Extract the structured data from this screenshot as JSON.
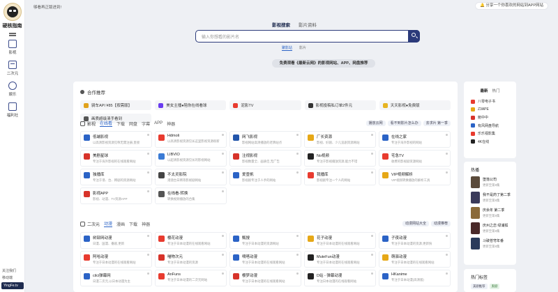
{
  "brand": {
    "name": "硬核指南"
  },
  "sidebar": {
    "items": [
      {
        "label": "影视",
        "icon": "film-icon"
      },
      {
        "label": "二次元",
        "icon": "anime-icon"
      },
      {
        "label": "娱乐",
        "icon": "game-icon"
      },
      {
        "label": "福利社",
        "icon": "gift-icon"
      }
    ],
    "bottom_text": "关注我们",
    "bottom_text2": "移动端",
    "site_badge": "YingFe.tv"
  },
  "topbar": {
    "welcome": "够看再正版进到!",
    "share": "分享一个你喜欢的网站到APP网站"
  },
  "hero": {
    "tabs": [
      "影视搜索",
      "影片资料"
    ],
    "search_placeholder": "输入你想看的影片名",
    "sub_tabs": [
      "聚影站",
      "影片"
    ],
    "note": "免费观看《最新云网》的影视网站、APP、网盘推荐"
  },
  "partners_title": "合作推荐",
  "partners": [
    {
      "label": "骑车API ¥85【按需版】",
      "color": "#e0a21c"
    },
    {
      "label": "美女主播●陪你在线看球",
      "color": "#6a3cf0"
    },
    {
      "label": "泥影TV",
      "color": "#e83b2f"
    },
    {
      "label": "影视投稿私订单2件元",
      "color": "#333333"
    },
    {
      "label": "天天影视●免费版",
      "color": "#e6b422"
    },
    {
      "label": "画质超级清手看到",
      "color": "#555555"
    }
  ],
  "film_section": {
    "name": "影视",
    "tabs": [
      "在线看",
      "下载",
      "网盘",
      "字幕",
      "APP",
      "神器"
    ],
    "pills": [
      "播放云网",
      "看不到影片怎么办",
      "去求片 第一季"
    ]
  },
  "film_cards": [
    {
      "name": "低端影视",
      "desc": "以高清影视资源见称无需注册,直接",
      "color": "#2b63c6"
    },
    {
      "name": "Hdmoli",
      "desc": "以高清影视资源见长这里影视资源很新",
      "color": "#e83b2f"
    },
    {
      "name": "网飞影视",
      "desc": "影视网站高清播放的老牌站点",
      "color": "#2255aa"
    },
    {
      "name": "厂长资源",
      "desc": "影视、好剧、少儿追剧资源网站",
      "color": "#e6a817"
    },
    {
      "name": "在线之家",
      "desc": "专注于海外影视的网站",
      "color": "#2b63c6"
    },
    {
      "name": "美剧星球",
      "desc": "专注于海外影视的在线观看网站",
      "color": "#d7332a"
    },
    {
      "name": "LIBVIO",
      "desc": "以超清影视资源见长的影视网站",
      "color": "#3a7bd5"
    },
    {
      "name": "注视影视",
      "desc": "影视数量全、画质佳,无广告",
      "color": "#d7332a"
    },
    {
      "name": "No视频",
      "desc": "专注于影视播放资源,能力不错",
      "color": "#222222"
    },
    {
      "name": "宅急TV",
      "desc": "收费的影视剧资源网站",
      "color": "#e83b2f"
    },
    {
      "name": "独播库",
      "desc": "专注于港、台、韩剧的资源网站",
      "color": "#2b63c6"
    },
    {
      "name": "不太灵影院",
      "desc": "港澳台日韩等影视剧网站",
      "color": "#444444"
    },
    {
      "name": "爱壹帆",
      "desc": "影视剧专注于人手的网站",
      "color": "#2b63c6"
    },
    {
      "name": "我播库",
      "desc": "影视剧专注一个人的网站",
      "color": "#e83b2f"
    },
    {
      "name": "VIP视频解析",
      "desc": "VIP视频转换播放的解析工具",
      "color": "#e6a817"
    },
    {
      "name": "影视APP",
      "desc": "影视、动漫、TV资源APP",
      "color": "#d7332a"
    },
    {
      "name": "在线看-转换",
      "desc": "转换视频播放的合集",
      "color": "#555555"
    }
  ],
  "anime_section": {
    "name": "二次元",
    "tabs": [
      "动漫",
      "漫画",
      "下载",
      "神器"
    ],
    "pills": [
      "动漫网站大全",
      "动漫推荐"
    ]
  },
  "anime_cards": [
    {
      "name": "树部网动漫",
      "desc": "日漫、国漫、番剧,更新",
      "color": "#2b63c6"
    },
    {
      "name": "樱花动漫",
      "desc": "专注于日本动漫的在线观看网站",
      "color": "#e83b2f"
    },
    {
      "name": "甄搜",
      "desc": "专注于日本动漫的资源网站",
      "color": "#2b63c6"
    },
    {
      "name": "花子动漫",
      "desc": "专注于日本动漫的在线观看网站",
      "color": "#e6a817"
    },
    {
      "name": "子夜动漫",
      "desc": "专注于日本动漫的资源,更新快",
      "color": "#2b63c6"
    },
    {
      "name": "阿哈动漫",
      "desc": "专注于日本动漫的在线观看网站",
      "color": "#e83b2f"
    },
    {
      "name": "喵物次元",
      "desc": "专注于日本动漫的资源",
      "color": "#d7332a"
    },
    {
      "name": "嘀嗒动漫",
      "desc": "专注于日本动漫的在线观看网站",
      "color": "#2b63c6"
    },
    {
      "name": "MuteFun动漫",
      "desc": "专注于日本动漫的在线观看网站",
      "color": "#222222"
    },
    {
      "name": "萌驿动漫",
      "desc": "专注于日本动漫的在线观看网站",
      "color": "#e6a817"
    },
    {
      "name": "cilci弹幕网",
      "desc": "日漫二次元,以日本动漫为主",
      "color": "#2b63c6"
    },
    {
      "name": "AnFuns",
      "desc": "专注于日本动漫的二次元网站",
      "color": "#e83b2f"
    },
    {
      "name": "樱梦动漫",
      "desc": "专注于日本动漫的在线观看网站",
      "color": "#d7332a"
    },
    {
      "name": "D站 - 弹幕动漫",
      "desc": "专注日本动漫的在线观看网站",
      "color": "#222222"
    },
    {
      "name": "HKanime",
      "desc": "专注于日本动漫(高清版)",
      "color": "#2b63c6"
    }
  ],
  "right": {
    "tabs": [
      "最新",
      "热门"
    ],
    "items": [
      {
        "label": "八零电子书",
        "color": "#e83b2f"
      },
      {
        "label": "Z3APE",
        "color": "#e6a817"
      },
      {
        "label": "鲍中中",
        "color": "#d7332a"
      },
      {
        "label": "有风网盘导航",
        "color": "#2b63c6"
      },
      {
        "label": "乐乐视影集",
        "color": "#e83b2f"
      },
      {
        "label": "4K在线",
        "color": "#222222"
      }
    ],
    "hot_title": "热播",
    "hot": [
      {
        "title": "堕落公司",
        "sub": "更新至第8集",
        "color": "#5a4a3a"
      },
      {
        "title": "我不是药了第二季",
        "sub": "更新至第8集",
        "color": "#3a3a5a"
      },
      {
        "title": "庆余年 第二季",
        "sub": "更新至第8集",
        "color": "#8a6a3a"
      },
      {
        "title": "庆州之恋 绿浦狐",
        "sub": "更新至第8集",
        "color": "#4a2a2a"
      },
      {
        "title": "斗破苍穹年番",
        "sub": "更新至第8集",
        "color": "#2a3a5a"
      }
    ],
    "tags_title": "热门标签",
    "tags": [
      "美剧推荐",
      "奥剧"
    ]
  }
}
